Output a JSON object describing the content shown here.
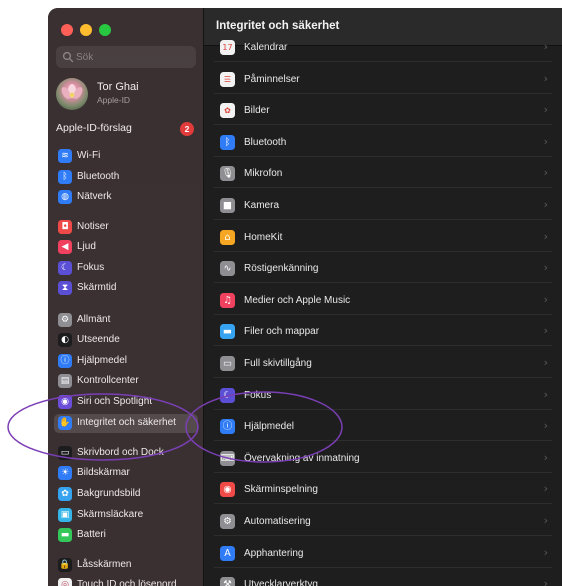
{
  "window_title": "Integritet och säkerhet",
  "search": {
    "placeholder": "Sök"
  },
  "profile": {
    "name": "Tor Ghai",
    "subtitle": "Apple-ID"
  },
  "suggestion": {
    "label": "Apple-ID-förslag",
    "badge": "2"
  },
  "sidebar": {
    "items": [
      {
        "label": "Wi-Fi",
        "icon": "wifi-icon",
        "color": "#2f7cf6",
        "glyph": "≋"
      },
      {
        "label": "Bluetooth",
        "icon": "bluetooth-icon",
        "color": "#2f7cf6",
        "glyph": "ᛒ"
      },
      {
        "label": "Nätverk",
        "icon": "globe-icon",
        "color": "#2f7cf6",
        "glyph": "◍"
      },
      {
        "label": "Notiser",
        "icon": "bell-icon",
        "color": "#f04a48",
        "glyph": "◘"
      },
      {
        "label": "Ljud",
        "icon": "speaker-icon",
        "color": "#f0415e",
        "glyph": "◀"
      },
      {
        "label": "Fokus",
        "icon": "moon-icon",
        "color": "#5b4fd6",
        "glyph": "☾"
      },
      {
        "label": "Skärmtid",
        "icon": "hourglass-icon",
        "color": "#5b4fd6",
        "glyph": "⧗"
      },
      {
        "label": "Allmänt",
        "icon": "gear-icon",
        "color": "#8e8e93",
        "glyph": "⚙"
      },
      {
        "label": "Utseende",
        "icon": "appearance-icon",
        "color": "#1c1c1e",
        "glyph": "◐"
      },
      {
        "label": "Hjälpmedel",
        "icon": "accessibility-icon",
        "color": "#2f7cf6",
        "glyph": "ⓘ"
      },
      {
        "label": "Kontrollcenter",
        "icon": "control-center-icon",
        "color": "#8e8e93",
        "glyph": "▤"
      },
      {
        "label": "Siri och Spotlight",
        "icon": "siri-icon",
        "color": "#6b4fd8",
        "glyph": "◉"
      },
      {
        "label": "Integritet och säkerhet",
        "icon": "hand-icon",
        "color": "#2f7cf6",
        "glyph": "✋"
      },
      {
        "label": "Skrivbord och Dock",
        "icon": "dock-icon",
        "color": "#1c1c1e",
        "glyph": "▭"
      },
      {
        "label": "Bildskärmar",
        "icon": "display-icon",
        "color": "#2f7cf6",
        "glyph": "☀"
      },
      {
        "label": "Bakgrundsbild",
        "icon": "wallpaper-icon",
        "color": "#36a3f0",
        "glyph": "✿"
      },
      {
        "label": "Skärmsläckare",
        "icon": "screensaver-icon",
        "color": "#36b5e8",
        "glyph": "▣"
      },
      {
        "label": "Batteri",
        "icon": "battery-icon",
        "color": "#34c759",
        "glyph": "▬"
      },
      {
        "label": "Låsskärmen",
        "icon": "lock-icon",
        "color": "#1c1c1e",
        "glyph": "🔒"
      },
      {
        "label": "Touch ID och lösenord",
        "icon": "fingerprint-icon",
        "color": "#f2f2f2",
        "glyph": "◎"
      }
    ]
  },
  "main": {
    "rows": [
      {
        "label": "Kalendrar",
        "icon": "calendar-icon",
        "color": "#f2f2f2",
        "glyph": "17"
      },
      {
        "label": "Påminnelser",
        "icon": "reminders-icon",
        "color": "#f2f2f2",
        "glyph": "☰"
      },
      {
        "label": "Bilder",
        "icon": "photos-icon",
        "color": "#f2f2f2",
        "glyph": "✿"
      },
      {
        "label": "Bluetooth",
        "icon": "bluetooth-icon",
        "color": "#2f7cf6",
        "glyph": "ᛒ"
      },
      {
        "label": "Mikrofon",
        "icon": "microphone-icon",
        "color": "#8e8e93",
        "glyph": "🎙"
      },
      {
        "label": "Kamera",
        "icon": "camera-icon",
        "color": "#8e8e93",
        "glyph": "■"
      },
      {
        "label": "HomeKit",
        "icon": "home-icon",
        "color": "#f5a623",
        "glyph": "⌂"
      },
      {
        "label": "Röstigenkänning",
        "icon": "waveform-icon",
        "color": "#8e8e93",
        "glyph": "∿"
      },
      {
        "label": "Medier och Apple Music",
        "icon": "music-icon",
        "color": "#f0415e",
        "glyph": "♫"
      },
      {
        "label": "Filer och mappar",
        "icon": "folder-icon",
        "color": "#36a3f0",
        "glyph": "▬"
      },
      {
        "label": "Full skivtillgång",
        "icon": "disk-icon",
        "color": "#8e8e93",
        "glyph": "▭"
      },
      {
        "label": "Fokus",
        "icon": "moon-icon",
        "color": "#5b4fd6",
        "glyph": "☾"
      },
      {
        "label": "Hjälpmedel",
        "icon": "accessibility-icon",
        "color": "#2f7cf6",
        "glyph": "ⓘ"
      },
      {
        "label": "Övervakning av inmatning",
        "icon": "keyboard-icon",
        "color": "#8e8e93",
        "glyph": "⌨"
      },
      {
        "label": "Skärminspelning",
        "icon": "record-icon",
        "color": "#f04a48",
        "glyph": "◉"
      },
      {
        "label": "Automatisering",
        "icon": "gears-icon",
        "color": "#8e8e93",
        "glyph": "⚙"
      },
      {
        "label": "Apphantering",
        "icon": "app-store-icon",
        "color": "#2f7cf6",
        "glyph": "A"
      },
      {
        "label": "Utvecklarverktyg",
        "icon": "hammer-icon",
        "color": "#8e8e93",
        "glyph": "⚒"
      }
    ]
  },
  "annotation_color": "#7b3fb5"
}
